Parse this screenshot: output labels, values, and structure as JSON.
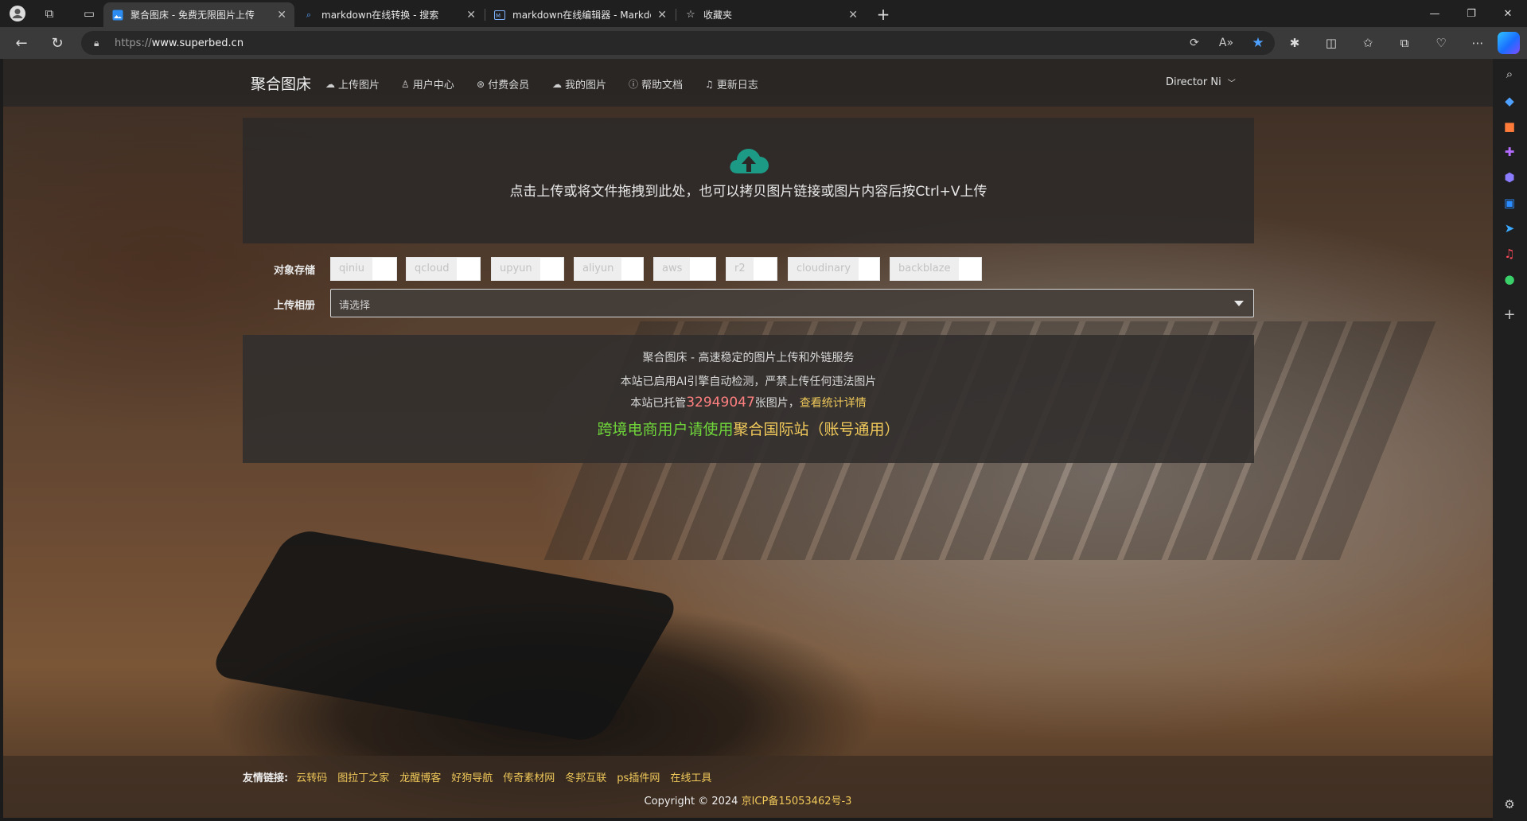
{
  "browser": {
    "tabs": [
      {
        "label": "聚合图床 - 免费无限图片上传",
        "icon": "image-icon",
        "active": true
      },
      {
        "label": "markdown在线转换 - 搜索",
        "icon": "search-icon",
        "active": false
      },
      {
        "label": "markdown在线编辑器 - Markdow",
        "icon": "markdown-icon",
        "active": false
      },
      {
        "label": "收藏夹",
        "icon": "favorites-icon",
        "active": false
      }
    ],
    "url_prefix": "https://",
    "url_host": "www.superbed.cn"
  },
  "site": {
    "brand": "聚合图床",
    "nav": [
      {
        "label": "上传图片",
        "icon": "cloud-upload-icon"
      },
      {
        "label": "用户中心",
        "icon": "user-icon"
      },
      {
        "label": "付费会员",
        "icon": "vip-icon"
      },
      {
        "label": "我的图片",
        "icon": "cloud-icon"
      },
      {
        "label": "帮助文档",
        "icon": "info-icon"
      },
      {
        "label": "更新日志",
        "icon": "bell-icon"
      }
    ],
    "user": "Director Ni"
  },
  "upload": {
    "prompt": "点击上传或将文件拖拽到此处，也可以拷贝图片链接或图片内容后按Ctrl+V上传",
    "accent_color": "#1c9a86"
  },
  "form": {
    "storage_label": "对象存储",
    "storage_options": [
      "qiniu",
      "qcloud",
      "upyun",
      "aliyun",
      "aws",
      "r2",
      "cloudinary",
      "backblaze"
    ],
    "album_label": "上传相册",
    "album_placeholder": "请选择"
  },
  "info": {
    "line1": "聚合图床 - 高速稳定的图片上传和外链服务",
    "line2": "本站已启用AI引擎自动检测，严禁上传任何违法图片",
    "line3_prefix": "本站已托管",
    "count": "32949047",
    "line3_suffix": "张图片，",
    "stats_link": "查看统计详情",
    "promo_prefix": "跨境电商用户请使用",
    "promo_link": "聚合国际站",
    "promo_suffix": "（账号通用）"
  },
  "footer": {
    "friend_label": "友情链接:",
    "friend_links": [
      "云转码",
      "图拉丁之家",
      "龙醒博客",
      "好狗导航",
      "传奇素材网",
      "冬邦互联",
      "ps插件网",
      "在线工具"
    ],
    "copyright": "Copyright © 2024",
    "icp": "京ICP备15053462号-3"
  },
  "colors": {
    "link_yellow": "#f0c95a",
    "count_red": "#ff8080",
    "promo_green": "#6fd63a"
  }
}
